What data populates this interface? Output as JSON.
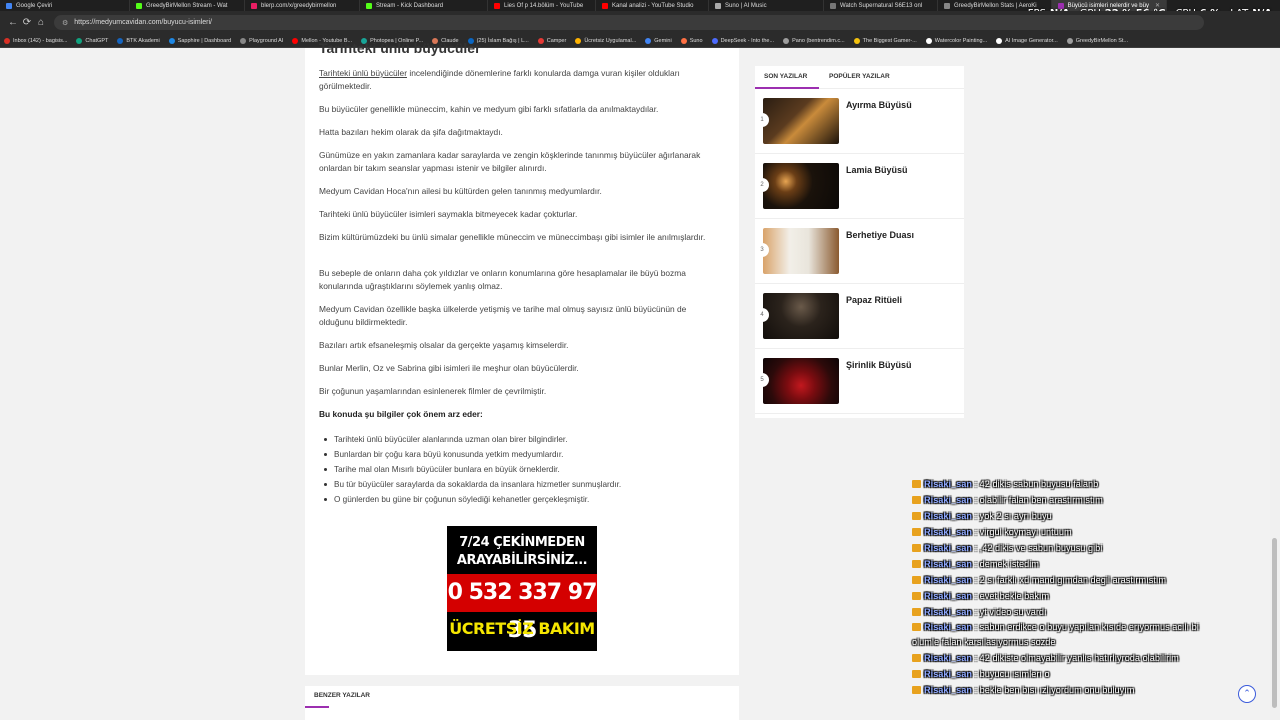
{
  "browser": {
    "tabs": [
      {
        "title": "Google Çeviri",
        "color": "#4285f4"
      },
      {
        "title": "GreedyBirMellon Stream - Wat",
        "color": "#53fc18"
      },
      {
        "title": "blerp.com/x/greedybirmellon",
        "color": "#e91e63"
      },
      {
        "title": "Stream - Kick Dashboard",
        "color": "#53fc18"
      },
      {
        "title": "Lies Of p 14.bölüm - YouTube",
        "color": "#ff0000"
      },
      {
        "title": "Kanal analizi - YouTube Studio",
        "color": "#ff0000"
      },
      {
        "title": "Suno | AI Music",
        "color": "#aaaaaa"
      },
      {
        "title": "Watch Supernatural S6E13 onl",
        "color": "#777777"
      },
      {
        "title": "GreedyBirMellon Stats | AeroKi",
        "color": "#888888"
      },
      {
        "title": "Büyücü isimleri nelerdir ve büy",
        "color": "#9c2fb0"
      }
    ],
    "url": "https://medyumcavidan.com/buyucu-isimleri/",
    "bookmarks": [
      {
        "label": "Inbox (142) - bagisis...",
        "color": "#d93025"
      },
      {
        "label": "ChatGPT",
        "color": "#10a37f"
      },
      {
        "label": "BTK Akademi",
        "color": "#1565c0"
      },
      {
        "label": "Sapphire | Dashboard",
        "color": "#1e88e5"
      },
      {
        "label": "Playground AI",
        "color": "#888888"
      },
      {
        "label": "Mellon - Youtube B...",
        "color": "#ff0000"
      },
      {
        "label": "Photopea | Online P...",
        "color": "#18a497"
      },
      {
        "label": "Claude",
        "color": "#d97757"
      },
      {
        "label": "(25) İslam Bağış | L...",
        "color": "#0a66c2"
      },
      {
        "label": "Camper",
        "color": "#e53935"
      },
      {
        "label": "Ücretsiz Uygulamal...",
        "color": "#ffb300"
      },
      {
        "label": "Gemini",
        "color": "#4285f4"
      },
      {
        "label": "Suno",
        "color": "#ff7043"
      },
      {
        "label": "DeepSeek - Into the...",
        "color": "#4d6bfe"
      },
      {
        "label": "Pano (bentrendim.c...",
        "color": "#9e9e9e"
      },
      {
        "label": "The Biggest Gamer-...",
        "color": "#f4c20d"
      },
      {
        "label": "Watercolor Painting...",
        "color": "#ffffff"
      },
      {
        "label": "AI Image Generator...",
        "color": "#ffffff"
      },
      {
        "label": "GreedyBirMellon St...",
        "color": "#9e9e9e"
      }
    ]
  },
  "hud": {
    "fps_label": "FPS",
    "fps_value": "N/A",
    "gpu_label": "GPU",
    "gpu_value": "22 %  56 °C",
    "cpu_label": "CPU",
    "cpu_value": "6 %",
    "lat_label": "LAT",
    "lat_value": "N/A"
  },
  "article": {
    "heading_partial": "Tarihteki ünlü büyücüler",
    "p1_link": "Tarihteki ünlü büyücüler",
    "p1_rest": " incelendiğinde dönemlerine farklı konularda damga vuran kişiler oldukları görülmektedir.",
    "paragraphs": [
      "Bu büyücüler genellikle müneccim, kahin ve medyum gibi farklı sıfatlarla da anılmaktaydılar.",
      "Hatta bazıları hekim olarak da şifa dağıtmaktaydı.",
      "Günümüze en yakın zamanlara kadar saraylarda ve zengin köşklerinde tanınmış büyücüler ağırlanarak onlardan bir takım seanslar yapması istenir ve bilgiler alınırdı.",
      "Medyum Cavidan Hoca'nın ailesi bu kültürden gelen tanınmış medyumlardır.",
      "Tarihteki ünlü büyücüler isimleri saymakla bitmeyecek kadar çokturlar.",
      "Bizim kültürümüzdeki bu ünlü simalar genellikle müneccim ve müneccimbaşı gibi isimler ile anılmışlardır.",
      "Bu sebeple de onların daha çok yıldızlar ve onların konumlarına göre hesaplamalar ile büyü bozma konularında uğraştıklarını söylemek yanlış olmaz.",
      "Medyum Cavidan özellikle başka ülkelerde yetişmiş ve tarihe mal olmuş sayısız ünlü büyücünün de olduğunu bildirmektedir.",
      "Bazıları artık efsaneleşmiş olsalar da gerçekte yaşamış kimselerdir.",
      "Bunlar Merlin, Oz ve Sabrina gibi isimleri ile meşhur olan büyücülerdir.",
      "Bir çoğunun yaşamlarından esinlenerek filmler de çevrilmiştir."
    ],
    "bold_paragraph": "Bu konuda şu bilgiler çok önem arz eder:",
    "list": [
      "Tarihteki ünlü büyücüler alanlarında uzman olan birer bilgindirler.",
      "Bunlardan bir çoğu kara büyü konusunda yetkim medyumlardır.",
      "Tarihe mal olan Mısırlı büyücüler bunlara en büyük örneklerdir.",
      "Bu tür büyücüler saraylarda da sokaklarda da insanlara hizmetler sunmuşlardır.",
      "O günlerden bu güne bir çoğunun söylediği kehanetler gerçekleşmiştir."
    ],
    "ad": {
      "line1": "7/24 ÇEKİNMEDEN",
      "line2": "ARAYABİLİRSİNİZ...",
      "phone": "0 532 337 97 35",
      "free": "ÜCRETSİZ BAKIM"
    },
    "related_title": "BENZER YAZILAR"
  },
  "sidebar": {
    "tab_recent": "SON YAZILAR",
    "tab_popular": "POPÜLER YAZILAR",
    "posts": [
      {
        "num": "1",
        "title": "Ayırma Büyüsü"
      },
      {
        "num": "2",
        "title": "Lamia Büyüsü"
      },
      {
        "num": "3",
        "title": "Berhetiye Duası"
      },
      {
        "num": "4",
        "title": "Papaz Ritüeli"
      },
      {
        "num": "5",
        "title": "Şirinlik Büyüsü"
      }
    ]
  },
  "chat": [
    {
      "user": "Risaki_san",
      "text": ": 42 dikis sabun buyusu falanb"
    },
    {
      "user": "Risaki_san",
      "text": ": olabilir falan ben arastırmıstım"
    },
    {
      "user": "Risaki_san",
      "text": ": yok 2 sı ayrı buyu"
    },
    {
      "user": "Risaki_san",
      "text": ": virgul koymayı untuum"
    },
    {
      "user": "Risaki_san",
      "text": ": ,42 dikis ve sabun buyusu gibi"
    },
    {
      "user": "Risaki_san",
      "text": ": demek istedim"
    },
    {
      "user": "Risaki_san",
      "text": ": 2 sı farklı xd mandıgımdan degil arastırmıstım"
    },
    {
      "user": "Risaki_san",
      "text": ": evet bekle bakım"
    },
    {
      "user": "Risaki_san",
      "text": ": yt video su vardı"
    },
    {
      "user": "Risaki_san",
      "text": ": sabun erdikce o buyu yapılan kısıde erıyormus acılı bi olumle falan karsılasıyormus sozde"
    },
    {
      "user": "Risaki_san",
      "text": ": 42 dikiste olmayabilir yanlıs hatırlıyroda olabilirim"
    },
    {
      "user": "Risaki_san",
      "text": ": buyucu ısımlerı o"
    },
    {
      "user": "Risaki_san",
      "text": ": bekle ben bısı ızlıyordum onu buluyım"
    }
  ]
}
